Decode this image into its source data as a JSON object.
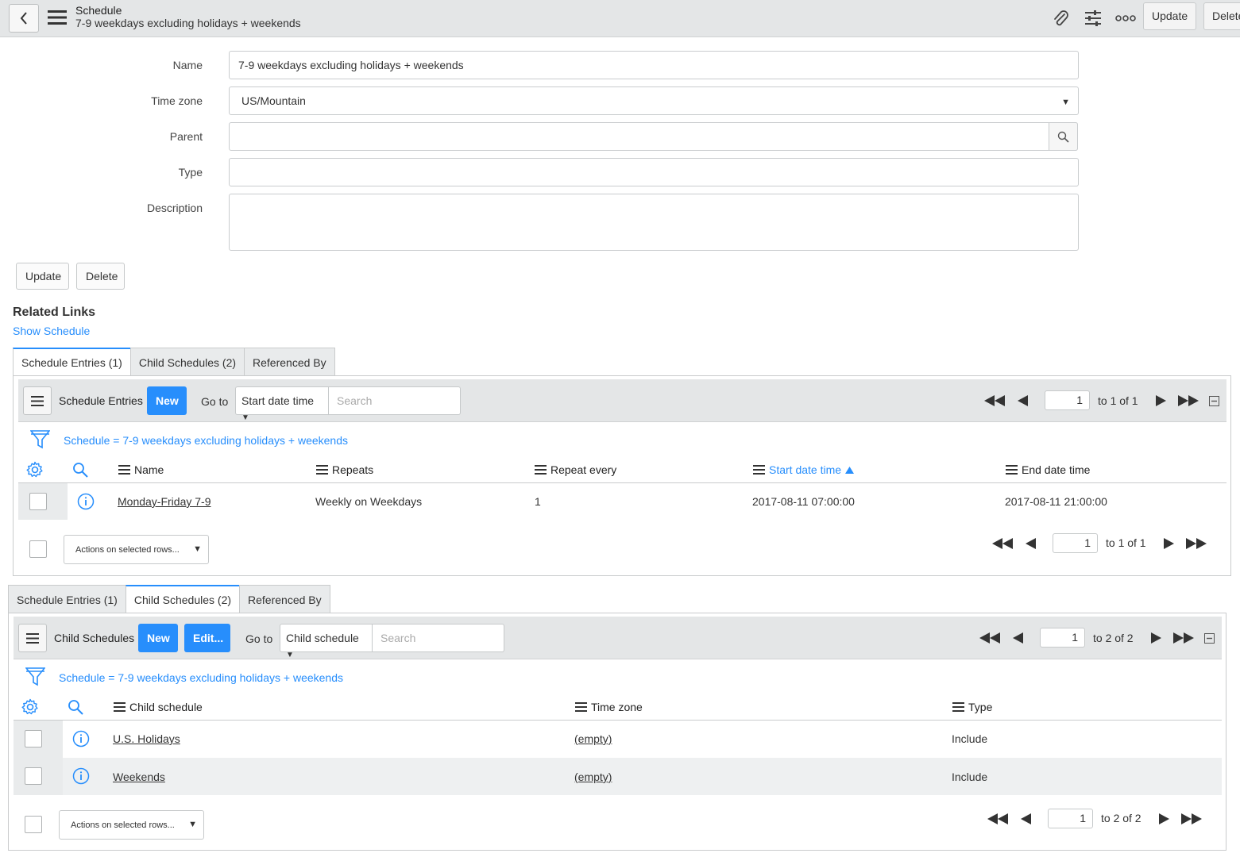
{
  "header": {
    "title": "Schedule",
    "subtitle": "7-9 weekdays excluding holidays + weekends",
    "update_label": "Update",
    "delete_label": "Delete"
  },
  "form": {
    "name_label": "Name",
    "name_value": "7-9 weekdays excluding holidays + weekends",
    "timezone_label": "Time zone",
    "timezone_value": "US/Mountain",
    "parent_label": "Parent",
    "parent_value": "",
    "type_label": "Type",
    "type_value": "",
    "description_label": "Description",
    "description_value": "",
    "update_label": "Update",
    "delete_label": "Delete"
  },
  "related_links": {
    "title": "Related Links",
    "show_schedule": "Show Schedule"
  },
  "tabs": [
    "Schedule Entries (1)",
    "Child Schedules (2)",
    "Referenced By"
  ],
  "schedule_entries": {
    "title": "Schedule Entries",
    "new_label": "New",
    "goto_label": "Go to",
    "goto_field": "Start date time",
    "search_placeholder": "Search",
    "page_value": "1",
    "page_text": "to 1 of 1",
    "filter": "Schedule = 7-9 weekdays excluding holidays + weekends",
    "columns": [
      "Name",
      "Repeats",
      "Repeat every",
      "Start date time",
      "End date time"
    ],
    "sorted_column": "Start date time",
    "sort_direction": "ascending",
    "rows": [
      {
        "name": "Monday-Friday 7-9",
        "repeats": "Weekly on Weekdays",
        "repeat_every": "1",
        "start": "2017-08-11 07:00:00",
        "end": "2017-08-11 21:00:00"
      }
    ],
    "actions_label": "Actions on selected rows...",
    "footer_page_value": "1",
    "footer_page_text": "to 1 of 1"
  },
  "child_schedules": {
    "title": "Child Schedules",
    "new_label": "New",
    "edit_label": "Edit...",
    "goto_label": "Go to",
    "goto_field": "Child schedule",
    "search_placeholder": "Search",
    "page_value": "1",
    "page_text": "to 2 of 2",
    "filter": "Schedule = 7-9 weekdays excluding holidays + weekends",
    "columns": [
      "Child schedule",
      "Time zone",
      "Type"
    ],
    "rows": [
      {
        "child": "U.S. Holidays",
        "timezone": "(empty)",
        "type": "Include"
      },
      {
        "child": "Weekends",
        "timezone": "(empty)",
        "type": "Include"
      }
    ],
    "actions_label": "Actions on selected rows...",
    "footer_page_value": "1",
    "footer_page_text": "to 2 of 2"
  },
  "colors": {
    "accent": "#278efc",
    "header_bg": "#e4e6e7",
    "row_alt": "#eef0f1"
  },
  "icons": [
    "back-icon",
    "menu-icon",
    "paperclip-icon",
    "settings-sliders-icon",
    "more-icon",
    "search-icon",
    "filter-icon",
    "gear-icon",
    "info-icon",
    "first-page-icon",
    "prev-page-icon",
    "next-page-icon",
    "last-page-icon",
    "collapse-icon"
  ]
}
